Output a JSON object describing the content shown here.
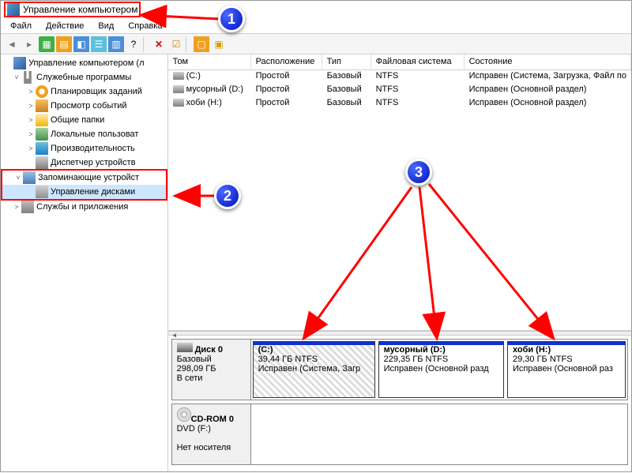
{
  "window": {
    "title": "Управление компьютером"
  },
  "menu": {
    "file": "Файл",
    "action": "Действие",
    "view": "Вид",
    "help": "Справка"
  },
  "tree": {
    "root": "Управление компьютером (л",
    "systools": "Служебные программы",
    "scheduler": "Планировщик заданий",
    "events": "Просмотр событий",
    "shared": "Общие папки",
    "users": "Локальные пользоват",
    "perf": "Производительность",
    "devmgr": "Диспетчер устройств",
    "storage": "Запоминающие устройст",
    "diskmgmt": "Управление дисками",
    "services": "Службы и приложения"
  },
  "columns": {
    "vol": "Том",
    "layout": "Расположение",
    "type": "Тип",
    "fs": "Файловая система",
    "status": "Состояние"
  },
  "vols": [
    {
      "name": "(C:)",
      "layout": "Простой",
      "type": "Базовый",
      "fs": "NTFS",
      "status": "Исправен (Система, Загрузка, Файл по"
    },
    {
      "name": "мусорный (D:)",
      "layout": "Простой",
      "type": "Базовый",
      "fs": "NTFS",
      "status": "Исправен (Основной раздел)"
    },
    {
      "name": "хоби (H:)",
      "layout": "Простой",
      "type": "Базовый",
      "fs": "NTFS",
      "status": "Исправен (Основной раздел)"
    }
  ],
  "disk0": {
    "name": "Диск 0",
    "type": "Базовый",
    "size": "298,09 ГБ",
    "status": "В сети",
    "p1": {
      "name": "(C:)",
      "size": "39,44 ГБ NTFS",
      "status": "Исправен (Система, Загр"
    },
    "p2": {
      "name": "мусорный (D:)",
      "size": "229,35 ГБ NTFS",
      "status": "Исправен (Основной разд"
    },
    "p3": {
      "name": "хоби (H:)",
      "size": "29,30 ГБ NTFS",
      "status": "Исправен (Основной раз"
    }
  },
  "cdrom": {
    "name": "CD-ROM 0",
    "type": "DVD (F:)",
    "status": "Нет носителя"
  },
  "callouts": {
    "n1": "1",
    "n2": "2",
    "n3": "3"
  }
}
